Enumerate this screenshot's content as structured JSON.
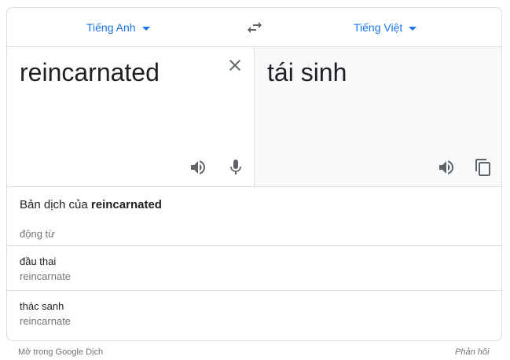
{
  "languages": {
    "source": "Tiếng Anh",
    "target": "Tiếng Việt"
  },
  "input": {
    "text": "reincarnated"
  },
  "output": {
    "text": "tái sinh"
  },
  "details": {
    "heading_prefix": "Bản dịch của",
    "heading_term": "reincarnated",
    "part_of_speech": "động từ",
    "entries": [
      {
        "word": "đầu thai",
        "back": "reincarnate"
      },
      {
        "word": "thác sanh",
        "back": "reincarnate"
      }
    ]
  },
  "footer": {
    "open_link": "Mở trong Google Dịch",
    "feedback": "Phản hồi"
  },
  "icons": {
    "swap": "swap-icon",
    "clear": "close-icon",
    "speak": "speaker-icon",
    "mic": "microphone-icon",
    "copy": "copy-icon",
    "caret": "caret-down-icon"
  },
  "colors": {
    "accent": "#1a73e8",
    "icon": "#5f6368",
    "muted": "#70757a",
    "border": "#dadce0",
    "target_bg": "#f8f9fa"
  }
}
